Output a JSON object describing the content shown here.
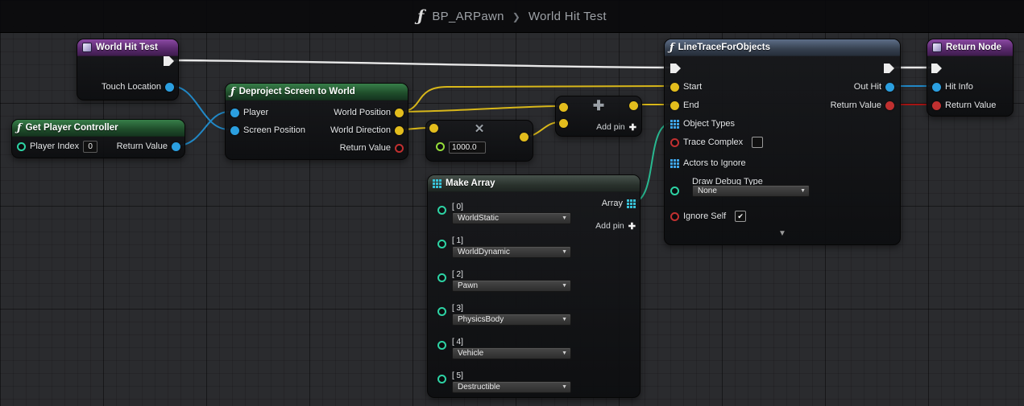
{
  "ui": {
    "function_icon": "ƒ",
    "dropdown_arrow": "▼",
    "checkmark": "✔",
    "collapse_arrow": "▼",
    "plus_icon": "✚",
    "multiply_icon": "✕"
  },
  "header": {
    "breadcrumb_root": "BP_ARPawn",
    "breadcrumb_separator": "❯",
    "breadcrumb_current": "World Hit Test"
  },
  "nodes": {
    "world_hit_test": {
      "title": "World Hit Test",
      "touch_location": "Touch Location"
    },
    "get_player_controller": {
      "title": "Get Player Controller",
      "player_index": "Player Index",
      "player_index_value": "0",
      "return_value": "Return Value"
    },
    "deproject_screen_to_world": {
      "title": "Deproject Screen to World",
      "player": "Player",
      "screen_position": "Screen Position",
      "world_position": "World Position",
      "world_direction": "World Direction",
      "return_value": "Return Value"
    },
    "multiply": {
      "value": "1000.0"
    },
    "add": {
      "add_pin": "Add pin"
    },
    "make_array": {
      "title": "Make Array",
      "array": "Array",
      "add_pin": "Add pin",
      "items": [
        {
          "index": "[ 0]",
          "value": "WorldStatic"
        },
        {
          "index": "[ 1]",
          "value": "WorldDynamic"
        },
        {
          "index": "[ 2]",
          "value": "Pawn"
        },
        {
          "index": "[ 3]",
          "value": "PhysicsBody"
        },
        {
          "index": "[ 4]",
          "value": "Vehicle"
        },
        {
          "index": "[ 5]",
          "value": "Destructible"
        }
      ]
    },
    "line_trace_for_objects": {
      "title": "LineTraceForObjects",
      "start": "Start",
      "end": "End",
      "object_types": "Object Types",
      "trace_complex": "Trace Complex",
      "trace_complex_checked": false,
      "actors_to_ignore": "Actors to Ignore",
      "draw_debug_type": "Draw Debug Type",
      "draw_debug_type_value": "None",
      "ignore_self": "Ignore Self",
      "ignore_self_checked": true,
      "out_hit": "Out Hit",
      "return_value": "Return Value"
    },
    "return_node": {
      "title": "Return Node",
      "hit_info": "Hit Info",
      "return_value": "Return Value"
    }
  },
  "colors": {
    "exec_wire": "#e8e8e8",
    "vector_pin": "#e3bd1d",
    "object_pin": "#2b9fe0",
    "bool_pin": "#c03030",
    "enum_pin": "#2dd3a4",
    "float_pin": "#95dd3a",
    "array_object_pin": "#3fa4e8",
    "array_cyan_pin": "#38c2d8",
    "header_purple": "#7e3f96",
    "header_green": "#2f6b3f",
    "header_steel": "#4e5f77"
  }
}
